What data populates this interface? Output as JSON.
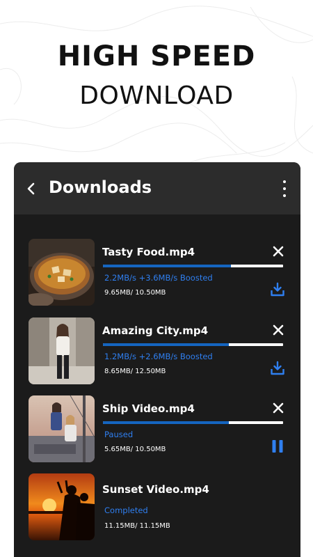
{
  "promo": {
    "headline": "HIGH SPEED",
    "subheadline": "DOWNLOAD"
  },
  "appbar": {
    "title": "Downloads",
    "back_icon": "chevron-left-icon",
    "menu_icon": "more-vertical-icon"
  },
  "colors": {
    "accent": "#1565c0",
    "status_text": "#2f7ff0",
    "app_bg": "#1b1b1b",
    "appbar_bg": "#2c2c2c"
  },
  "downloads": [
    {
      "name": "Tasty Food.mp4",
      "status": "2.2MB/s  +3.6MB/s Boosted",
      "size": "9.65MB/ 10.50MB",
      "progress": 0.71,
      "action": "download-icon",
      "closable": true
    },
    {
      "name": "Amazing City.mp4",
      "status": "1.2MB/s  +2.6MB/s Boosted",
      "size": "8.65MB/ 12.50MB",
      "progress": 0.7,
      "action": "download-icon",
      "closable": true
    },
    {
      "name": "Ship Video.mp4",
      "status": "Paused",
      "size": "5.65MB/ 10.50MB",
      "progress": 0.7,
      "action": "pause-icon",
      "closable": true
    },
    {
      "name": "Sunset Video.mp4",
      "status": "Completed",
      "size": "11.15MB/ 11.15MB",
      "progress": 1.0,
      "action": null,
      "closable": false
    }
  ]
}
